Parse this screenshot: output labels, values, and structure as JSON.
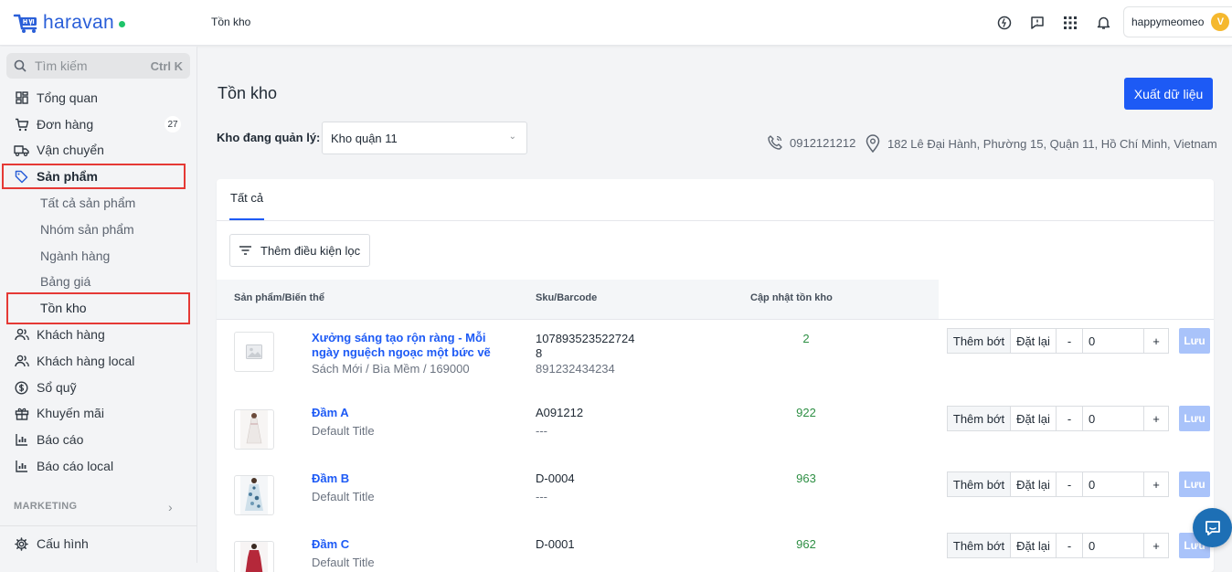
{
  "app": {
    "brand": "haravan",
    "brand_color": "#2a5fd8",
    "accent": "#1d5af5"
  },
  "header": {
    "breadcrumb": "Tồn kho",
    "user_name": "happymeomeo",
    "avatar_letter": "V"
  },
  "sidebar": {
    "search_placeholder": "Tìm kiếm",
    "search_shortcut": "Ctrl K",
    "items": [
      {
        "label": "Tổng quan",
        "icon": "dashboard-icon"
      },
      {
        "label": "Đơn hàng",
        "icon": "cart-icon",
        "badge": "27"
      },
      {
        "label": "Vận chuyển",
        "icon": "truck-icon"
      },
      {
        "label": "Sản phẩm",
        "icon": "tag-icon",
        "active": true
      },
      {
        "label": "Khách hàng",
        "icon": "users-icon"
      },
      {
        "label": "Khách hàng local",
        "icon": "users-icon"
      },
      {
        "label": "Sổ quỹ",
        "icon": "dollar-icon"
      },
      {
        "label": "Khuyến mãi",
        "icon": "gift-icon"
      },
      {
        "label": "Báo cáo",
        "icon": "chart-icon"
      },
      {
        "label": "Báo cáo local",
        "icon": "chart-icon"
      }
    ],
    "subitems": [
      "Tất cả sản phẩm",
      "Nhóm sản phẩm",
      "Ngành hàng",
      "Bảng giá",
      "Tồn kho"
    ],
    "section_label": "MARKETING",
    "settings_label": "Cấu hình"
  },
  "main": {
    "title": "Tồn kho",
    "export_label": "Xuất dữ liệu",
    "warehouse_label": "Kho đang quản lý:",
    "warehouse_value": "Kho quận 11",
    "phone": "0912121212",
    "address": "182 Lê Đại Hành, Phường 15, Quận 11, Hồ Chí Minh, Vietnam",
    "tab_all": "Tất cả",
    "filter_label": "Thêm điều kiện lọc",
    "columns": {
      "product": "Sản phẩm/Biến thể",
      "sku": "Sku/Barcode",
      "update": "Cập nhật tồn kho"
    },
    "controls": {
      "adjust": "Thêm bớt",
      "reset": "Đặt lại",
      "minus": "-",
      "plus": "+",
      "save": "Lưu"
    },
    "rows": [
      {
        "name_line1": "Xưởng sáng tạo rộn ràng - Mỗi",
        "name_line2": "ngày nguệch ngoạc một bức vẽ",
        "variant": "Sách Mới / Bìa Mềm / 169000",
        "sku_line1": "107893523522724",
        "sku_line2": "8",
        "barcode": "891232434234",
        "qty": "2",
        "input": "0"
      },
      {
        "name_line1": "Đầm A",
        "variant": "Default Title",
        "sku_line1": "A091212",
        "barcode": "---",
        "qty": "922",
        "input": "0"
      },
      {
        "name_line1": "Đầm B",
        "variant": "Default Title",
        "sku_line1": "D-0004",
        "barcode": "---",
        "qty": "963",
        "input": "0"
      },
      {
        "name_line1": "Đầm C",
        "variant": "Default Title",
        "sku_line1": "D-0001",
        "barcode": "",
        "qty": "962",
        "input": "0"
      }
    ]
  }
}
